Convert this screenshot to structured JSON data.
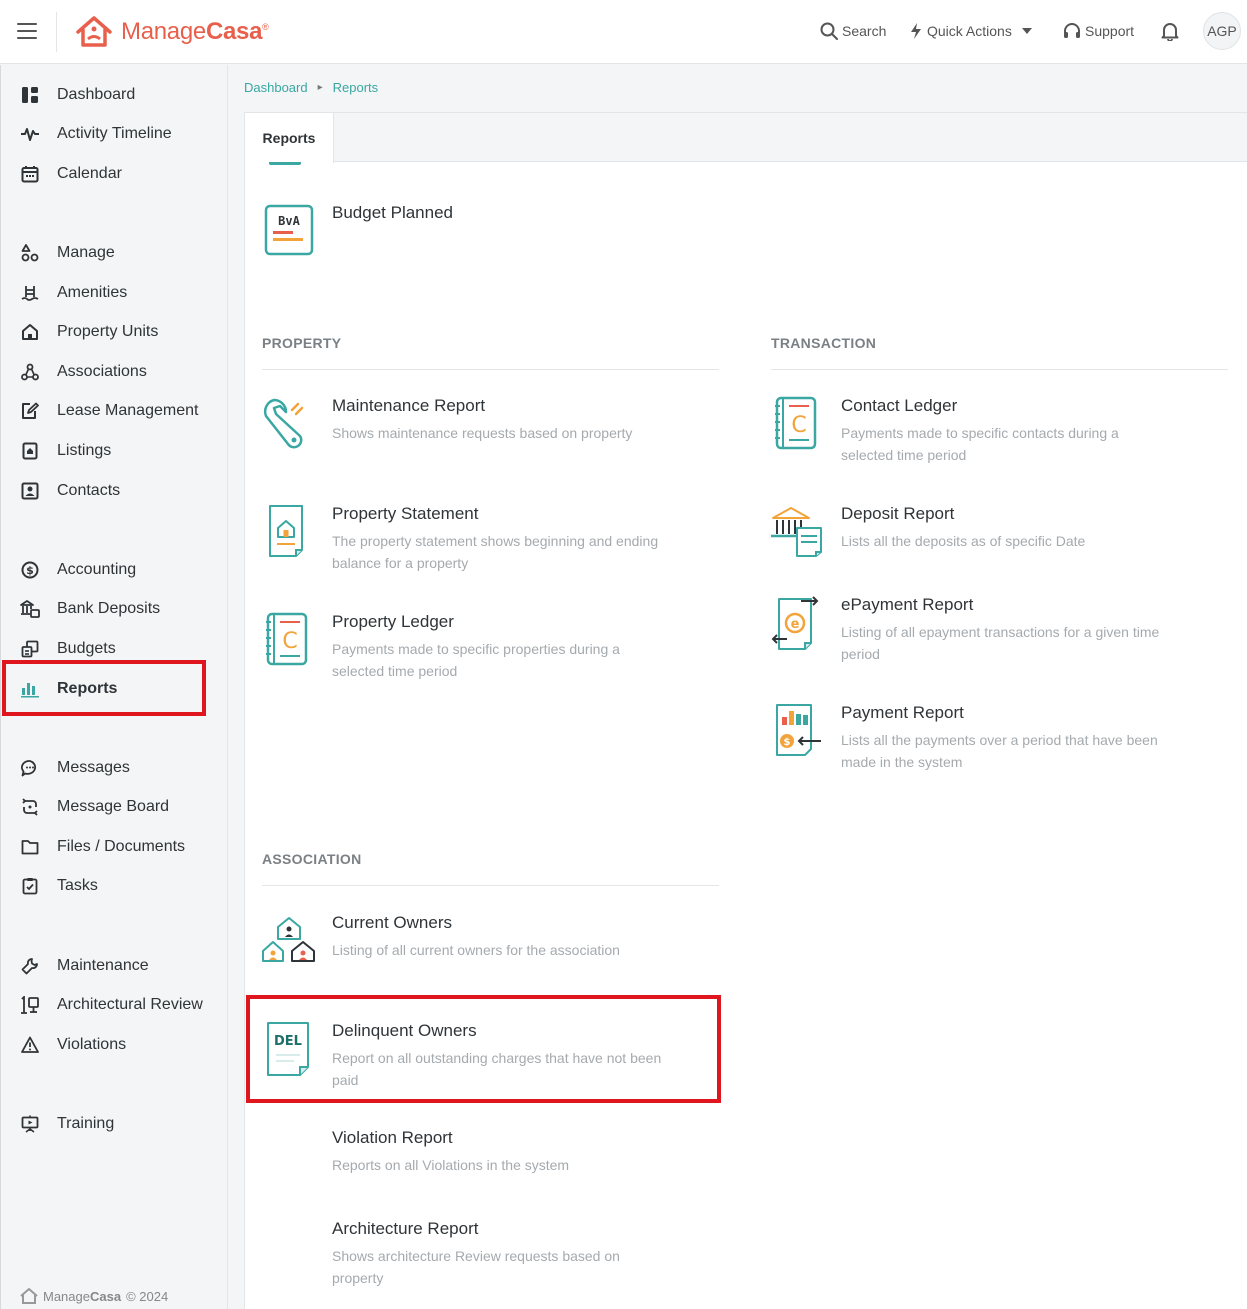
{
  "app": {
    "brand_name": "Manage",
    "brand_name_bold": "Casa",
    "brand_mark": "®"
  },
  "topbar": {
    "search_label": "Search",
    "quick_actions_label": "Quick Actions",
    "support_label": "Support",
    "avatar_initials": "AGP"
  },
  "sidebar": {
    "items": [
      {
        "label": "Dashboard",
        "icon": "dashboard-icon"
      },
      {
        "label": "Activity Timeline",
        "icon": "activity-icon"
      },
      {
        "label": "Calendar",
        "icon": "calendar-icon"
      },
      {
        "label": "Manage",
        "icon": "manage-icon"
      },
      {
        "label": "Amenities",
        "icon": "amenities-icon"
      },
      {
        "label": "Property Units",
        "icon": "home-icon"
      },
      {
        "label": "Associations",
        "icon": "associations-icon"
      },
      {
        "label": "Lease Management",
        "icon": "lease-icon"
      },
      {
        "label": "Listings",
        "icon": "listings-icon"
      },
      {
        "label": "Contacts",
        "icon": "contacts-icon"
      },
      {
        "label": "Accounting",
        "icon": "dollar-icon"
      },
      {
        "label": "Bank Deposits",
        "icon": "bank-icon"
      },
      {
        "label": "Budgets",
        "icon": "budget-icon"
      },
      {
        "label": "Reports",
        "icon": "bar-chart-icon",
        "active": true
      },
      {
        "label": "Messages",
        "icon": "chat-icon"
      },
      {
        "label": "Message Board",
        "icon": "message-board-icon"
      },
      {
        "label": "Files / Documents",
        "icon": "folder-icon"
      },
      {
        "label": "Tasks",
        "icon": "tasks-icon"
      },
      {
        "label": "Maintenance",
        "icon": "wrench-icon"
      },
      {
        "label": "Architectural Review",
        "icon": "review-icon"
      },
      {
        "label": "Violations",
        "icon": "warning-icon"
      },
      {
        "label": "Training",
        "icon": "training-icon"
      }
    ],
    "footer_brand": "Manage",
    "footer_brand_bold": "Casa",
    "footer_copyright": "© 2024"
  },
  "breadcrumb": {
    "home": "Dashboard",
    "current": "Reports"
  },
  "tabs": {
    "active": "Reports"
  },
  "reports": {
    "budget": {
      "title": "Budget Planned",
      "icon_text": "BvA"
    },
    "property": {
      "section": "PROPERTY",
      "items": [
        {
          "title": "Maintenance Report",
          "desc": "Shows maintenance requests based on property"
        },
        {
          "title": "Property Statement",
          "desc": "The property statement shows beginning and ending balance for a property"
        },
        {
          "title": "Property Ledger",
          "desc": "Payments made to specific properties during a selected time period"
        }
      ]
    },
    "transaction": {
      "section": "TRANSACTION",
      "items": [
        {
          "title": "Contact Ledger",
          "desc": "Payments made to specific contacts during a selected time period"
        },
        {
          "title": "Deposit Report",
          "desc": "Lists all the deposits as of specific Date"
        },
        {
          "title": "ePayment Report",
          "desc": "Listing of all epayment transactions for a given time period"
        },
        {
          "title": "Payment Report",
          "desc": "Lists all the payments over a period that have been made in the system"
        }
      ]
    },
    "association": {
      "section": "ASSOCIATION",
      "items": [
        {
          "title": "Current Owners",
          "desc": "Listing of all current owners for the association"
        },
        {
          "title": "Delinquent Owners",
          "desc": "Report on all outstanding charges that have not been paid",
          "icon_text": "DEL"
        },
        {
          "title": "Violation Report",
          "desc": "Reports on all Violations in the system"
        },
        {
          "title": "Architecture Report",
          "desc": "Shows architecture Review requests based on property"
        }
      ]
    }
  },
  "colors": {
    "accent": "#3aa7a2",
    "brand": "#e8604c",
    "highlight": "#e0161e"
  }
}
